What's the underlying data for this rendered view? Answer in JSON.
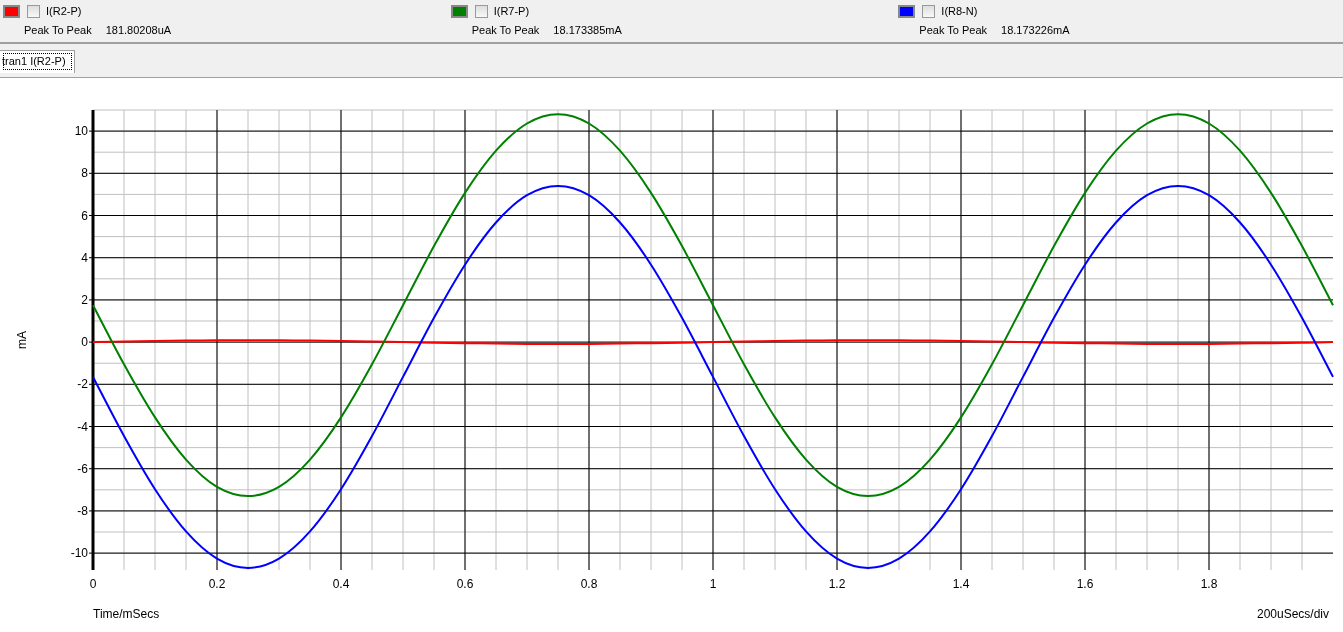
{
  "legend": [
    {
      "color": "#ff0000",
      "checked": false,
      "label": "I(R2-P)",
      "measure_label": "Peak To Peak",
      "measure_value": "181.80208uA"
    },
    {
      "color": "#008000",
      "checked": false,
      "label": "I(R7-P)",
      "measure_label": "Peak To Peak",
      "measure_value": "18.173385mA"
    },
    {
      "color": "#0000ff",
      "checked": false,
      "label": "I(R8-N)",
      "measure_label": "Peak To Peak",
      "measure_value": "18.173226mA"
    }
  ],
  "tabs": [
    {
      "label": "tran1 I(R2-P)",
      "selected": true
    }
  ],
  "plot": {
    "scale_label": "200uSecs/div",
    "chart_data": {
      "type": "line",
      "grid": true,
      "xlabel": "Time/mSecs",
      "ylabel": "mA",
      "xlim": [
        0,
        2
      ],
      "ylim": [
        -10.8,
        11
      ],
      "xticks": [
        0,
        0.2,
        0.4,
        0.6,
        0.8,
        1,
        1.2,
        1.4,
        1.6,
        1.8
      ],
      "yticks": [
        -10,
        -8,
        -6,
        -4,
        -2,
        0,
        2,
        4,
        6,
        8,
        10
      ],
      "x": [
        0,
        0.05,
        0.1,
        0.15,
        0.2,
        0.25,
        0.3,
        0.35,
        0.4,
        0.45,
        0.5,
        0.55,
        0.6,
        0.65,
        0.7,
        0.75,
        0.8,
        0.85,
        0.9,
        0.95,
        1,
        1.05,
        1.1,
        1.15,
        1.2,
        1.25,
        1.3,
        1.35,
        1.4,
        1.45,
        1.5,
        1.55,
        1.6,
        1.65,
        1.7,
        1.75,
        1.8,
        1.85,
        1.9,
        1.95,
        2
      ],
      "series": [
        {
          "color": "#ff0000",
          "values": [
            0,
            0.03,
            0.05,
            0.07,
            0.09,
            0.09,
            0.09,
            0.07,
            0.05,
            0.03,
            0,
            -0.03,
            -0.05,
            -0.07,
            -0.09,
            -0.09,
            -0.09,
            -0.07,
            -0.05,
            -0.03,
            0,
            0.03,
            0.05,
            0.07,
            0.09,
            0.09,
            0.09,
            0.07,
            0.05,
            0.03,
            0,
            -0.03,
            -0.05,
            -0.07,
            -0.09,
            -0.09,
            -0.09,
            -0.07,
            -0.05,
            -0.03,
            0
          ]
        },
        {
          "color": "#008000",
          "values": [
            1.75,
            -1.05,
            -3.57,
            -5.57,
            -6.86,
            -7.3,
            -6.86,
            -5.57,
            -3.57,
            -1.05,
            1.75,
            4.55,
            7.07,
            9.07,
            10.36,
            10.8,
            10.36,
            9.07,
            7.07,
            4.55,
            1.75,
            -1.05,
            -3.57,
            -5.57,
            -6.86,
            -7.3,
            -6.86,
            -5.57,
            -3.57,
            -1.05,
            1.75,
            4.55,
            7.07,
            9.07,
            10.36,
            10.8,
            10.36,
            9.07,
            7.07,
            4.55,
            1.75
          ]
        },
        {
          "color": "#0000ff",
          "values": [
            -1.65,
            -4.45,
            -6.97,
            -8.97,
            -10.26,
            -10.7,
            -10.26,
            -8.97,
            -6.97,
            -4.45,
            -1.65,
            1.15,
            3.67,
            5.67,
            6.96,
            7.4,
            6.96,
            5.67,
            3.67,
            1.15,
            -1.65,
            -4.45,
            -6.97,
            -8.97,
            -10.26,
            -10.7,
            -10.26,
            -8.97,
            -6.97,
            -4.45,
            -1.65,
            1.15,
            3.67,
            5.67,
            6.96,
            7.4,
            6.96,
            5.67,
            3.67,
            1.15,
            -1.65
          ]
        }
      ]
    }
  }
}
